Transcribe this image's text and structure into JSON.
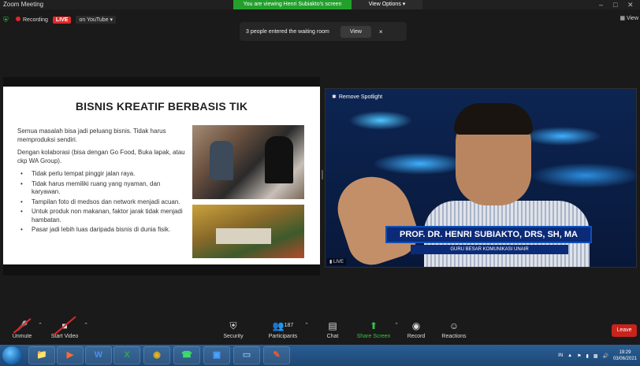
{
  "window": {
    "title": "Zoom Meeting",
    "viewing_banner": "You are viewing Henri Subiakto's screen",
    "view_options": "View Options ▾"
  },
  "recording": {
    "label": "Recording",
    "live": "LIVE",
    "platform": "on YouTube ▾"
  },
  "top_right": {
    "view_label": "View"
  },
  "notification": {
    "message": "3 people entered the waiting room",
    "view_button": "View",
    "close": "×"
  },
  "slide": {
    "title": "BISNIS KREATIF BERBASIS TIK",
    "para1": "Semua masalah bisa jadi peluang bisnis. Tidak harus memproduksi sendiri.",
    "para2": "Dengan  kolaborasi (bisa dengan Go Food, Buka lapak, atau ckp WA Group).",
    "bullets": [
      "Tidak perlu tempat pinggir jalan raya.",
      "Tidak harus memiliki ruang yang nyaman, dan karyawan.",
      "Tampilan foto di medsos dan network menjadi acuan.",
      "Untuk produk non makanan, faktor jarak tidak menjadi hambatan.",
      "Pasar jadi lebih luas daripada bisnis di dunia fisik."
    ]
  },
  "speaker": {
    "remove_spotlight": "Remove Spotlight",
    "name": "PROF. DR. HENRI SUBIAKTO, DRS, SH, MA",
    "role": "GURU BESAR KOMUNIKASI UNAIR",
    "live_tag": "LIVE"
  },
  "toolbar": {
    "unmute": "Unmute",
    "start_video": "Start Video",
    "security": "Security",
    "participants": "Participants",
    "participants_count": "187",
    "chat": "Chat",
    "share_screen": "Share Screen",
    "record": "Record",
    "reactions": "Reactions",
    "leave": "Leave"
  },
  "taskbar": {
    "language": "IN",
    "time": "19:29",
    "date": "03/06/2021"
  },
  "colors": {
    "share_green": "#31c841",
    "live_red": "#e02828",
    "banner_green": "#23a02c",
    "name_banner_blue": "#0b2a78"
  }
}
